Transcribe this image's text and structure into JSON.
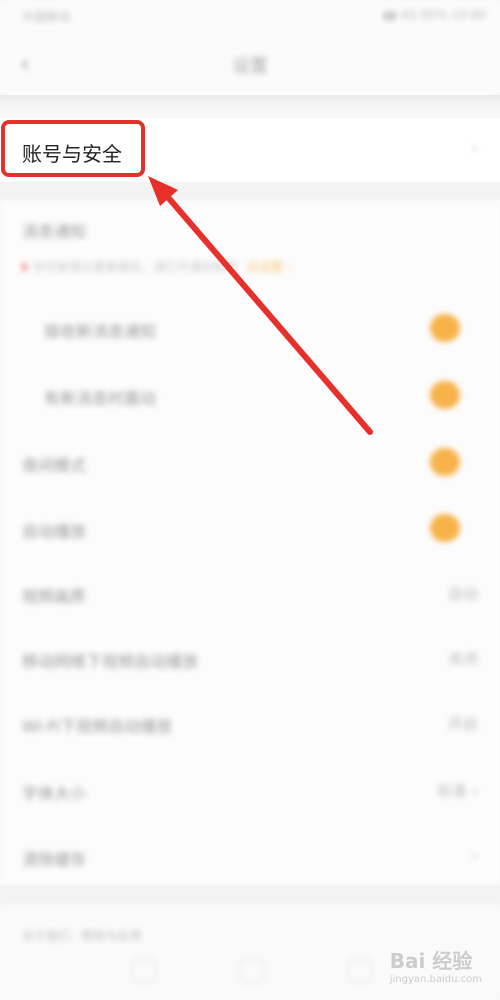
{
  "status_bar": {
    "left": "中国移动",
    "right": "▮▮ 4G 95% 10:00"
  },
  "nav": {
    "back_icon": "back-arrow-icon",
    "title": "设置"
  },
  "account": {
    "label": "账号与安全",
    "chevron": "›"
  },
  "highlight": {
    "color": "#e8302b"
  },
  "rows": {
    "r1": {
      "label": "消息通知"
    },
    "r1_sub": {
      "text": "你可能错过重要通知，请打开通知权限",
      "tag": "去设置 ›"
    },
    "r2": {
      "label": "接收新消息通知"
    },
    "r3": {
      "label": "有新消息时震动"
    },
    "r4": {
      "label": "夜间模式"
    },
    "r5": {
      "label": "自动播放"
    },
    "r6": {
      "label": "视频画质",
      "value": "自动"
    },
    "r7": {
      "label": "移动网络下视频自动播放",
      "value": "关闭"
    },
    "r8": {
      "label": "Wi-Fi下视频自动播放",
      "value": "开启"
    },
    "r9": {
      "label": "字体大小",
      "value": "标准 ›"
    },
    "r10": {
      "label": "清除缓存",
      "value": "›"
    }
  },
  "bottom": {
    "label": "关于我们 · 帮助与反馈"
  },
  "watermark": {
    "main": "Bai 经验",
    "sub": "jingyan.baidu.com"
  },
  "colors": {
    "accent_toggle": "#f7b24a",
    "annotation_red": "#e8302b"
  }
}
